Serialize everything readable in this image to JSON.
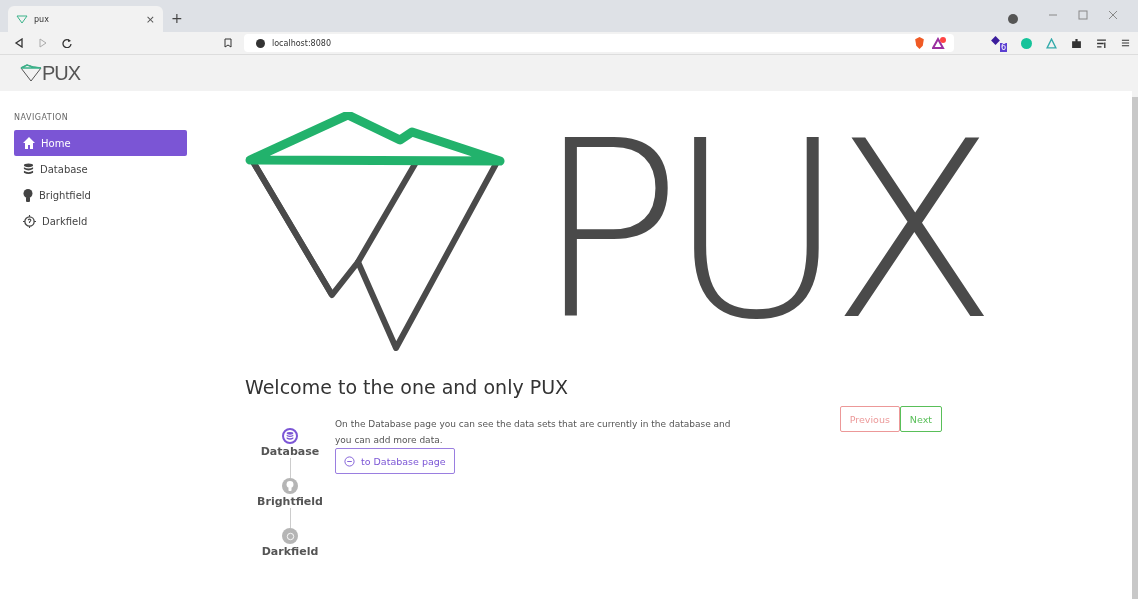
{
  "browser": {
    "tab_title": "pux",
    "tab_close": "×",
    "new_tab": "+",
    "address": "localhost:8080",
    "extension_badge": "6"
  },
  "header": {
    "logo_text": "PUX"
  },
  "sidebar": {
    "heading": "NAVIGATION",
    "items": [
      {
        "label": "Home",
        "selected": true
      },
      {
        "label": "Database",
        "selected": false
      },
      {
        "label": "Brightfield",
        "selected": false
      },
      {
        "label": "Darkfield",
        "selected": false
      }
    ]
  },
  "hero": {
    "logo_text": "PUX"
  },
  "welcome": {
    "title": "Welcome to the one and only PUX",
    "steps": [
      {
        "label": "Database",
        "selected": true
      },
      {
        "label": "Brightfield",
        "selected": false
      },
      {
        "label": "Darkfield",
        "selected": false
      }
    ],
    "description": "On the Database page you can see the data sets that are currently in the database and you can add more data.",
    "action": "to Database page",
    "buttons": [
      {
        "label": "Previous",
        "kind": "previous",
        "disabled": true
      },
      {
        "label": "Next",
        "kind": "next",
        "disabled": false
      }
    ]
  }
}
